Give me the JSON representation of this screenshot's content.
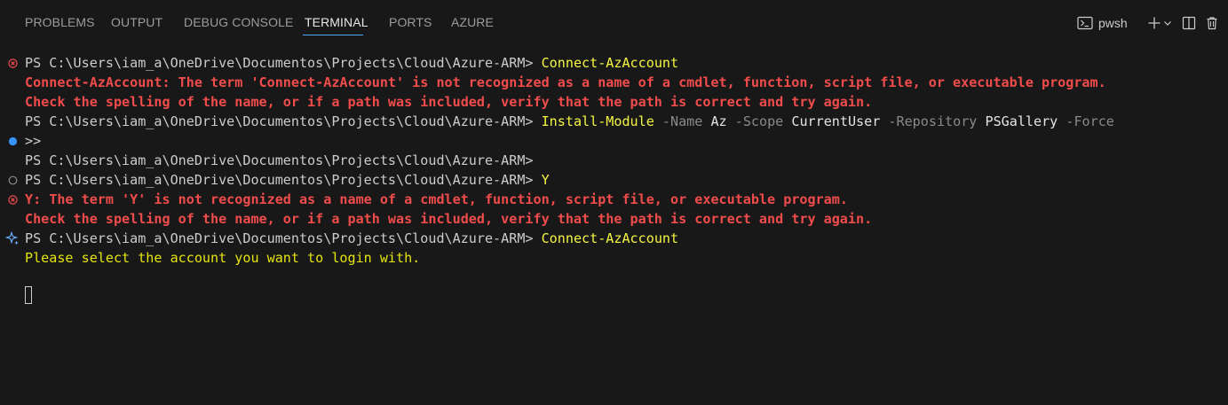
{
  "panel": {
    "tabs": [
      {
        "label": "PROBLEMS"
      },
      {
        "label": "OUTPUT"
      },
      {
        "label": "DEBUG CONSOLE"
      },
      {
        "label": "TERMINAL"
      },
      {
        "label": "PORTS"
      },
      {
        "label": "AZURE"
      }
    ],
    "active_tab": "TERMINAL",
    "shell_label": "pwsh"
  },
  "terminal": {
    "prompt": "PS C:\\Users\\iam_a\\OneDrive\\Documentos\\Projects\\Cloud\\Azure-ARM>",
    "lines": {
      "l1_cmd": "Connect-AzAccount",
      "l2": "Connect-AzAccount: The term 'Connect-AzAccount' is not recognized as a name of a cmdlet, function, script file, or executable program.",
      "l3": "Check the spelling of the name, or if a path was included, verify that the path is correct and try again.",
      "l4_cmd": "Install-Module",
      "l4_p1": "-Name",
      "l4_v1": "Az",
      "l4_p2": "-Scope",
      "l4_v2": "CurrentUser",
      "l4_p3": "-Repository",
      "l4_v3": "PSGallery",
      "l4_p4": "-Force",
      "l5": ">>",
      "l7_cmd": "Y",
      "l8": "Y: The term 'Y' is not recognized as a name of a cmdlet, function, script file, or executable program.",
      "l9": "Check the spelling of the name, or if a path was included, verify that the path is correct and try again.",
      "l10_cmd": "Connect-AzAccount",
      "l11": "Please select the account you want to login with."
    }
  },
  "colors": {
    "background": "#181818",
    "error": "#f14c4c",
    "command": "#f5f543",
    "accent": "#4daafc"
  },
  "icons": [
    "terminal-icon",
    "plus-icon",
    "chevron-down-icon",
    "split-icon",
    "trash-icon",
    "error-circle-icon",
    "info-dot-icon",
    "empty-circle-icon",
    "sparkle-icon"
  ]
}
